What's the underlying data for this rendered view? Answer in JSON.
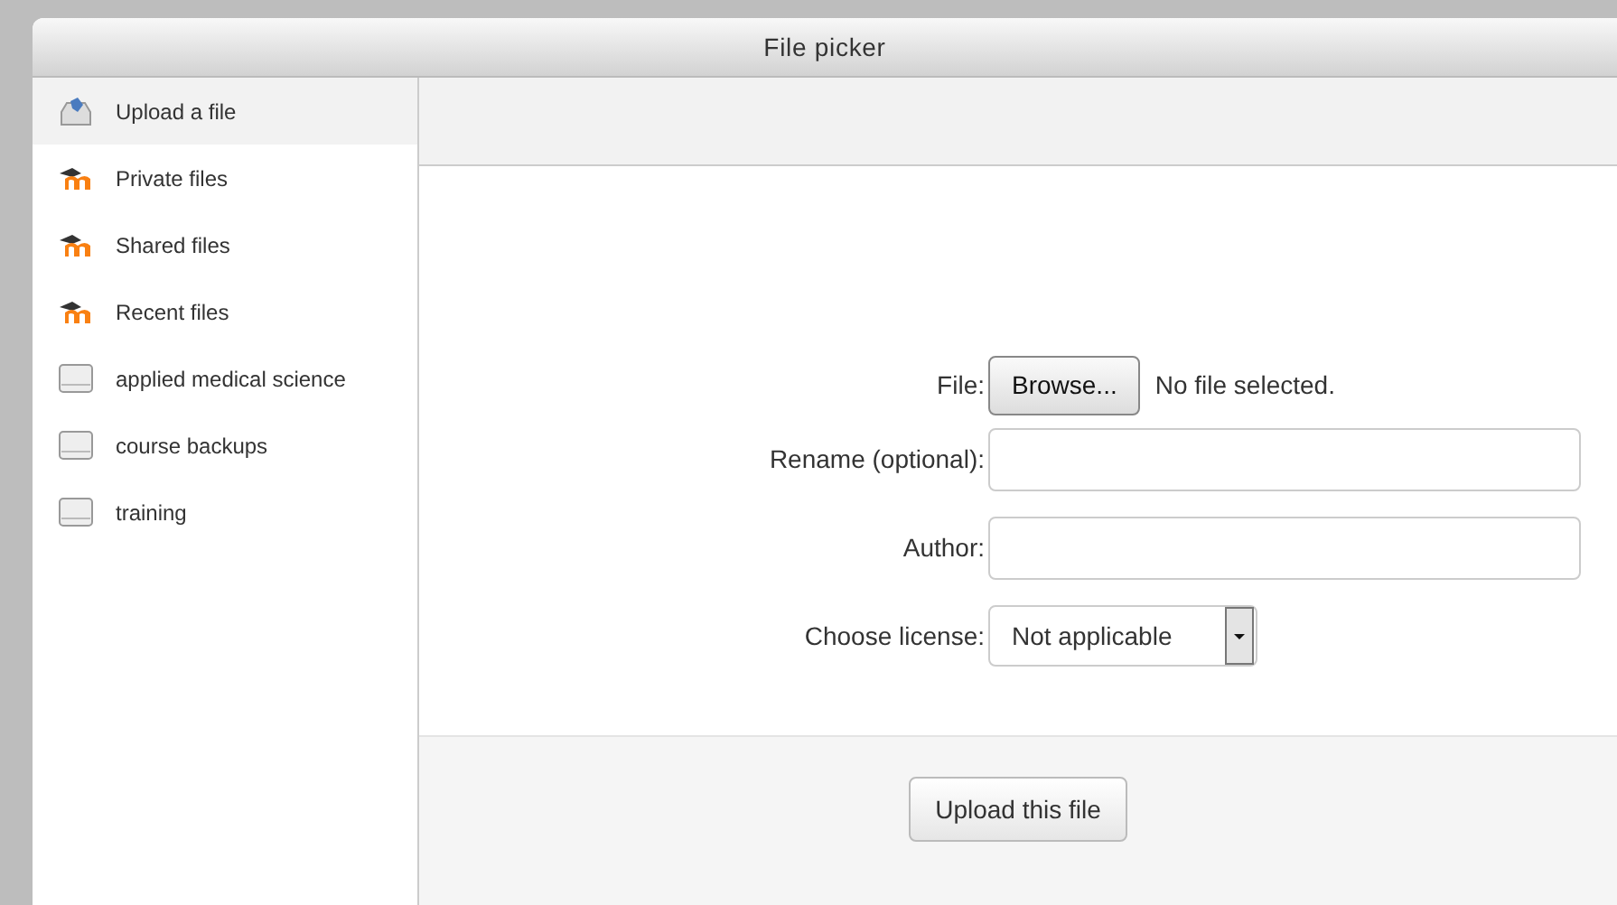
{
  "window": {
    "title": "File picker"
  },
  "sidebar": {
    "items": [
      {
        "label": "Upload a file",
        "kind": "upload",
        "selected": true
      },
      {
        "label": "Private files",
        "kind": "moodle",
        "selected": false
      },
      {
        "label": "Shared files",
        "kind": "moodle",
        "selected": false
      },
      {
        "label": "Recent files",
        "kind": "moodle",
        "selected": false
      },
      {
        "label": "applied medical science",
        "kind": "repository",
        "selected": false
      },
      {
        "label": "course backups",
        "kind": "repository",
        "selected": false
      },
      {
        "label": "training",
        "kind": "repository",
        "selected": false
      }
    ]
  },
  "form": {
    "file": {
      "label": "File:",
      "button": "Browse...",
      "status": "No file selected."
    },
    "rename": {
      "label": "Rename (optional):"
    },
    "author": {
      "label": "Author:"
    },
    "license": {
      "label": "Choose license:",
      "value": "Not applicable"
    }
  },
  "footer": {
    "button": "Upload this file"
  }
}
